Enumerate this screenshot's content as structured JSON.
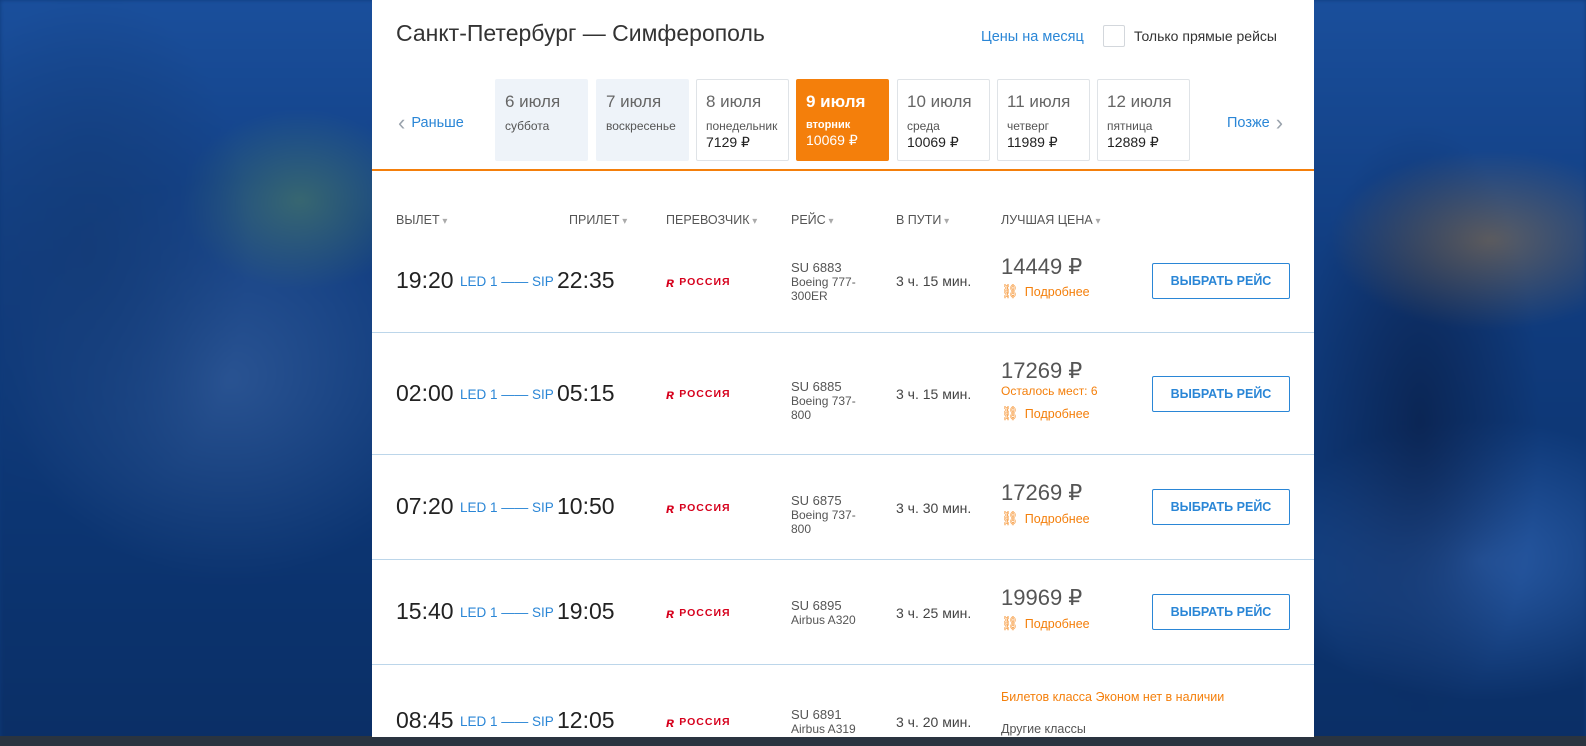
{
  "header": {
    "route": "Санкт-Петербург — Симферополь",
    "month_prices_link": "Цены на месяц",
    "direct_only_label": "Только прямые рейсы"
  },
  "date_nav": {
    "earlier": "Раньше",
    "later": "Позже",
    "dates": [
      {
        "date": "6 июля",
        "weekday": "суббота",
        "price": ""
      },
      {
        "date": "7 июля",
        "weekday": "воскресенье",
        "price": ""
      },
      {
        "date": "8 июля",
        "weekday": "понедельник",
        "price": "7129 ₽"
      },
      {
        "date": "9 июля",
        "weekday": "вторник",
        "price": "10069 ₽"
      },
      {
        "date": "10 июля",
        "weekday": "среда",
        "price": "10069 ₽"
      },
      {
        "date": "11 июля",
        "weekday": "четверг",
        "price": "11989 ₽"
      },
      {
        "date": "12 июля",
        "weekday": "пятница",
        "price": "12889 ₽"
      }
    ]
  },
  "columns": {
    "departure": "ВЫЛЕТ",
    "arrival": "ПРИЛЕТ",
    "carrier": "ПЕРЕВОЗЧИК",
    "flight": "РЕЙС",
    "duration": "В ПУТИ",
    "best_price": "ЛУЧШАЯ ЦЕНА"
  },
  "common": {
    "from_airport": "LED 1",
    "to_airport": "SIP",
    "carrier_name": "РОССИЯ",
    "more_label": "Подробнее",
    "select_label": "ВЫБРАТЬ РЕЙС"
  },
  "flights": [
    {
      "dep": "19:20",
      "arr": "22:35",
      "number": "SU 6883",
      "aircraft": "Boeing 777-300ER",
      "duration": "3 ч. 15 мин.",
      "price": "14449 ₽"
    },
    {
      "dep": "02:00",
      "arr": "05:15",
      "number": "SU 6885",
      "aircraft": "Boeing 737-800",
      "duration": "3 ч. 15 мин.",
      "price": "17269 ₽",
      "seats": "Осталось мест: 6"
    },
    {
      "dep": "07:20",
      "arr": "10:50",
      "number": "SU 6875",
      "aircraft": "Boeing 737-800",
      "duration": "3 ч. 30 мин.",
      "price": "17269 ₽"
    },
    {
      "dep": "15:40",
      "arr": "19:05",
      "number": "SU 6895",
      "aircraft": "Airbus A320",
      "duration": "3 ч. 25 мин.",
      "price": "19969 ₽"
    },
    {
      "dep": "08:45",
      "arr": "12:05",
      "number": "SU 6891",
      "aircraft": "Airbus A319",
      "duration": "3 ч. 20 мин.",
      "no_economy": "Билетов класса Эконом нет в наличии",
      "other_classes": "Другие классы"
    }
  ]
}
